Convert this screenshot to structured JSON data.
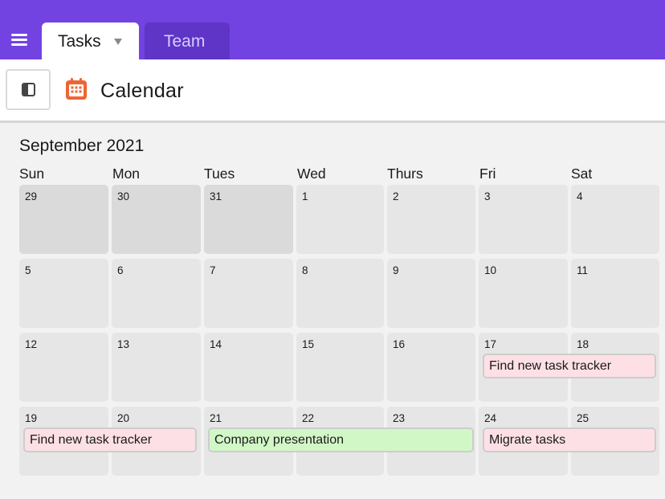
{
  "nav": {
    "tabs": [
      {
        "label": "Tasks"
      },
      {
        "label": "Team"
      }
    ]
  },
  "header": {
    "title": "Calendar"
  },
  "calendar": {
    "month": "September 2021",
    "weekdays": [
      "Sun",
      "Mon",
      "Tues",
      "Wed",
      "Thurs",
      "Fri",
      "Sat"
    ],
    "weeks": [
      [
        "29",
        "30",
        "31",
        "1",
        "2",
        "3",
        "4"
      ],
      [
        "5",
        "6",
        "7",
        "8",
        "9",
        "10",
        "11"
      ],
      [
        "12",
        "13",
        "14",
        "15",
        "16",
        "17",
        "18"
      ],
      [
        "19",
        "20",
        "21",
        "22",
        "23",
        "24",
        "25"
      ]
    ],
    "events": [
      {
        "title": "Find new task tracker",
        "color": "#fde0e5"
      },
      {
        "title": "Find new task tracker",
        "color": "#fde0e5"
      },
      {
        "title": "Company presentation",
        "color": "#d2f7c6"
      },
      {
        "title": "Migrate tasks",
        "color": "#fde0e5"
      }
    ]
  },
  "colors": {
    "topbar": "#7243e0",
    "tab_inactive": "#5e35c6",
    "calendar_icon": "#ee6535"
  },
  "icons": [
    "menu-icon",
    "chevron-down-icon",
    "sidebar-toggle-icon",
    "calendar-icon"
  ]
}
